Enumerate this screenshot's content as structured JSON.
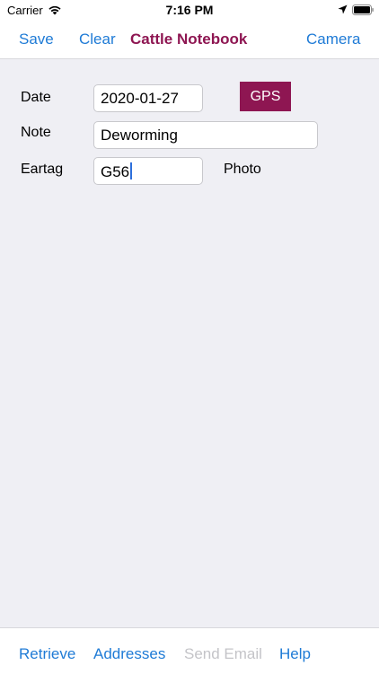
{
  "status_bar": {
    "carrier": "Carrier",
    "time": "7:16 PM"
  },
  "nav": {
    "save_label": "Save",
    "clear_label": "Clear",
    "title": "Cattle Notebook",
    "camera_label": "Camera"
  },
  "form": {
    "date_label": "Date",
    "date_value": "2020-01-27",
    "gps_label": "GPS",
    "note_label": "Note",
    "note_value": "Deworming",
    "eartag_label": "Eartag",
    "eartag_value": "G56",
    "photo_label": "Photo"
  },
  "toolbar": {
    "retrieve_label": "Retrieve",
    "addresses_label": "Addresses",
    "send_email_label": "Send Email",
    "help_label": "Help"
  },
  "colors": {
    "accent": "#1f7bd6",
    "brand": "#8e1652",
    "background": "#efeff4",
    "disabled": "#c4c4c8"
  },
  "icons": [
    "wifi-icon",
    "location-arrow-icon",
    "battery-icon"
  ]
}
